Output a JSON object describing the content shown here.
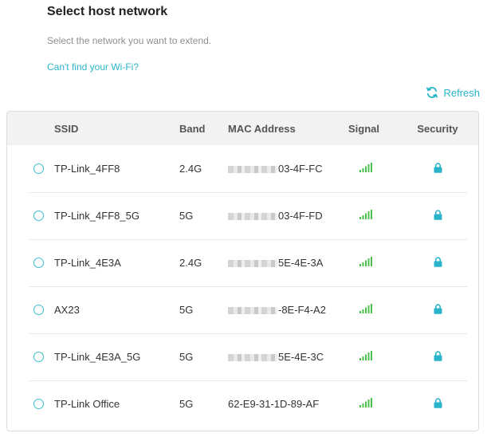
{
  "header": {
    "title": "Select host network",
    "subtitle": "Select the network you want to extend.",
    "help_link": "Can't find your Wi-Fi?"
  },
  "refresh": {
    "label": "Refresh"
  },
  "colors": {
    "accent": "#2ab4c9",
    "header_bg": "#f2f2f2"
  },
  "table": {
    "columns": {
      "ssid": "SSID",
      "band": "Band",
      "mac": "MAC Address",
      "signal": "Signal",
      "security": "Security"
    },
    "rows": [
      {
        "ssid": "TP-Link_4FF8",
        "band": "2.4G",
        "mac": "03-4F-FC",
        "signal": "signal-bars-icon",
        "security": "lock-icon"
      },
      {
        "ssid": "TP-Link_4FF8_5G",
        "band": "5G",
        "mac": "03-4F-FD",
        "signal": "signal-bars-icon",
        "security": "lock-icon"
      },
      {
        "ssid": "TP-Link_4E3A",
        "band": "2.4G",
        "mac": "5E-4E-3A",
        "signal": "signal-bars-icon",
        "security": "lock-icon"
      },
      {
        "ssid": "AX23",
        "band": "5G",
        "mac": "-8E-F4-A2",
        "signal": "signal-bars-icon",
        "security": "lock-icon"
      },
      {
        "ssid": "TP-Link_4E3A_5G",
        "band": "5G",
        "mac": "5E-4E-3C",
        "signal": "signal-bars-icon",
        "security": "lock-icon"
      },
      {
        "ssid": "TP-Link Office",
        "band": "5G",
        "mac": "62-E9-31-1D-89-AF",
        "signal": "signal-bars-icon",
        "security": "lock-icon"
      }
    ]
  }
}
